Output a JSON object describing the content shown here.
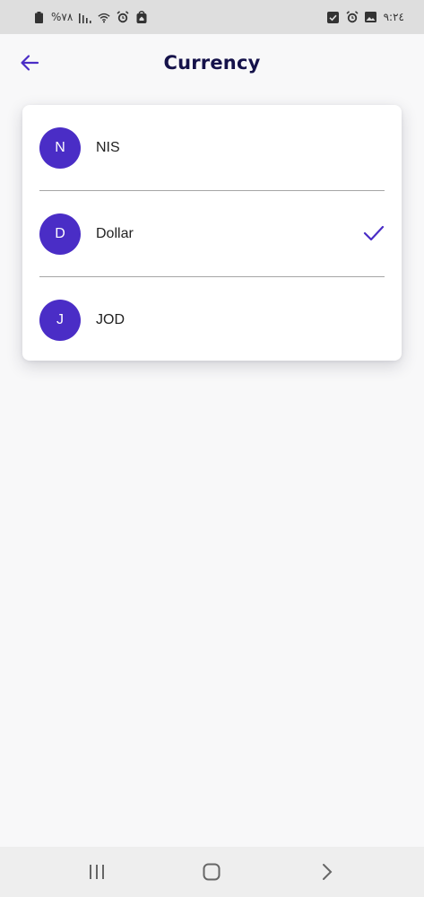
{
  "status_bar": {
    "battery_text": "%٧٨",
    "time": "٩:٢٤"
  },
  "header": {
    "title": "Currency",
    "back_icon": "arrow-left-icon"
  },
  "currencies": [
    {
      "initial": "N",
      "label": "NIS",
      "selected": false
    },
    {
      "initial": "D",
      "label": "Dollar",
      "selected": true
    },
    {
      "initial": "J",
      "label": "JOD",
      "selected": false
    }
  ],
  "colors": {
    "accent": "#4a2dc6",
    "title": "#15124a"
  },
  "nav_bar": {
    "icons": [
      "recents-icon",
      "home-icon",
      "back-chevron-icon"
    ]
  }
}
